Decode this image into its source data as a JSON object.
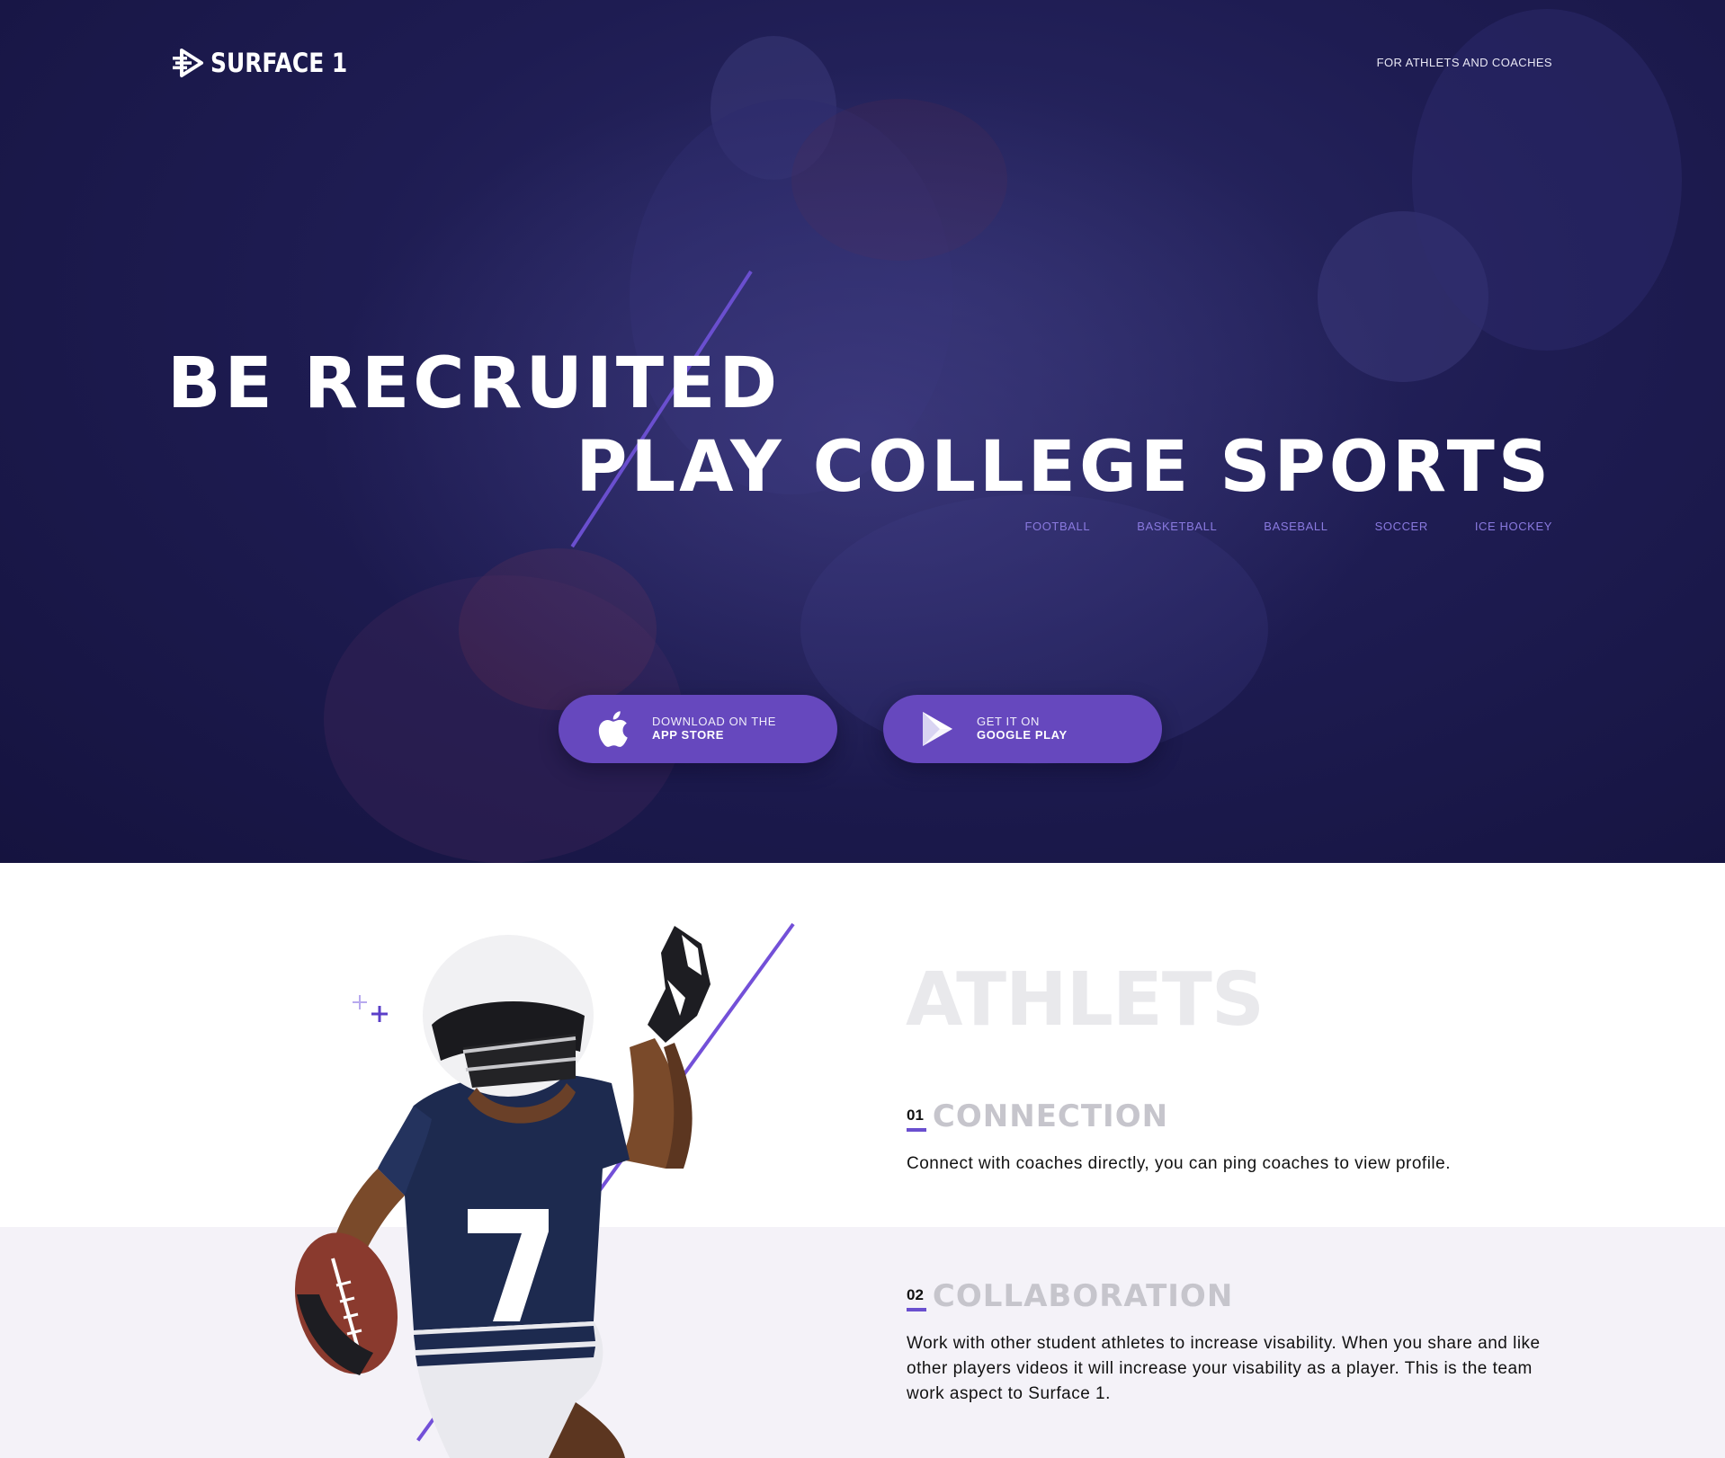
{
  "brand": {
    "name": "SURFACE 1",
    "accent": "#6648be",
    "dark": "#1e1c52"
  },
  "header": {
    "tagline": "FOR ATHLETS AND COACHES"
  },
  "hero": {
    "headline_1": "BE RECRUITED",
    "headline_2": "PLAY COLLEGE SPORTS",
    "sports": [
      "FOOTBALL",
      "BASKETBALL",
      "BASEBALL",
      "SOCCER",
      "ICE HOCKEY"
    ],
    "app_store": {
      "small": "DOWNLOAD ON THE",
      "big": "APP STORE",
      "icon": "apple-icon"
    },
    "google_play": {
      "small": "GET IT ON",
      "big": "GOOGLE PLAY",
      "icon": "play-icon"
    }
  },
  "athletes": {
    "title": "ATHLETS",
    "features": [
      {
        "num": "01",
        "title": "CONNECTION",
        "desc": "Connect with coaches directly, you can ping coaches to view profile."
      },
      {
        "num": "02",
        "title": "COLLABORATION",
        "desc": "Work with other student athletes to  increase visability. When you share and like other players videos it will increase your visability as a player. This is the team work aspect to Surface 1."
      }
    ]
  }
}
